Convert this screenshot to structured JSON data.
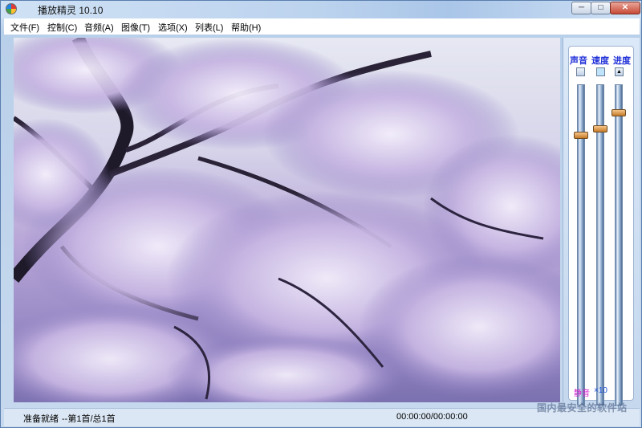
{
  "window": {
    "title": "播放精灵 10.10"
  },
  "title_buttons": {
    "minimize": "─",
    "maximize": "□",
    "close": "✕"
  },
  "menu": [
    {
      "label": "文件(F)"
    },
    {
      "label": "控制(C)"
    },
    {
      "label": "音频(A)"
    },
    {
      "label": "图像(T)"
    },
    {
      "label": "选项(X)"
    },
    {
      "label": "列表(L)"
    },
    {
      "label": "帮助(H)"
    }
  ],
  "panel": {
    "volume_label": "声音",
    "speed_label": "速度",
    "progress_label": "进度",
    "mute_label": "静音",
    "volume_readout": "×10",
    "volume_level": 0.85,
    "speed_level": 0.87,
    "progress_level": 0.92
  },
  "status": {
    "state": "准备就绪",
    "track": "--第1首/总1首",
    "time": "00:00:00/00:00:00"
  },
  "watermark": "国内最安全的软件站",
  "icons": [
    "app-icon",
    "minimize-icon",
    "maximize-icon",
    "close-icon",
    "mute-icon",
    "volume-icon"
  ],
  "colors": {
    "label_blue": "#1f2fd8",
    "mute_pink": "#d61ccf"
  }
}
